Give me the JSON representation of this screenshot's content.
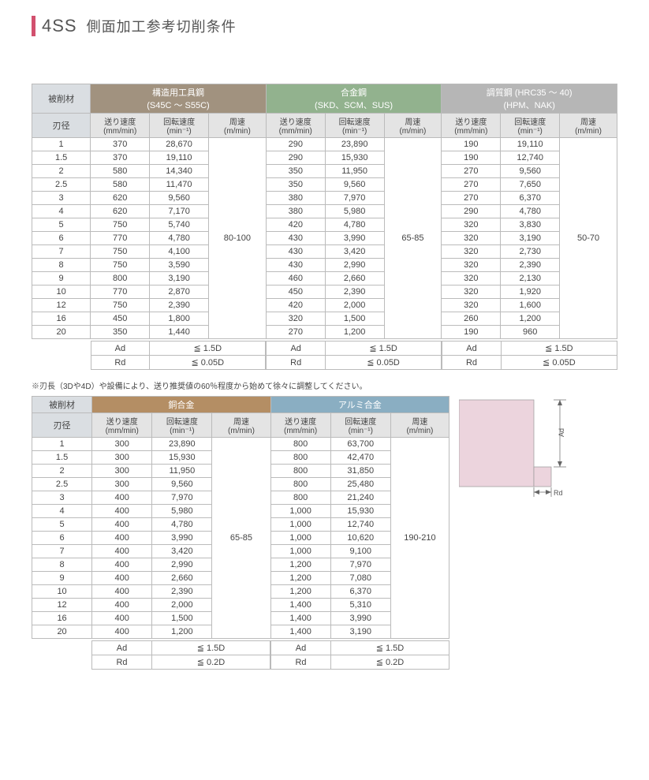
{
  "title": {
    "code": "4SS",
    "text": "側面加工参考切削条件"
  },
  "labels": {
    "material": "被削材",
    "diameter": "刃径",
    "feed": "送り速度",
    "feed_unit": "(mm/min)",
    "rotation": "回転速度",
    "rotation_unit": "(min⁻¹)",
    "surface": "周速",
    "surface_unit": "(m/min)",
    "ad": "Ad",
    "rd": "Rd",
    "le15d": "≦ 1.5D",
    "le005d": "≦ 0.05D",
    "le02d": "≦ 0.2D"
  },
  "note": "※刃長（3Dや4D）や設備により、送り推奨値の60％程度から始めて徐々に調整してください。",
  "diameters": [
    "1",
    "1.5",
    "2",
    "2.5",
    "3",
    "4",
    "5",
    "6",
    "7",
    "8",
    "9",
    "10",
    "12",
    "16",
    "20"
  ],
  "block1_groups": [
    {
      "title": "構造用工具鋼",
      "sub": "(S45C ～ S55C)",
      "cls": "g1",
      "surf": "80-100",
      "rows": [
        [
          "370",
          "28,670"
        ],
        [
          "370",
          "19,110"
        ],
        [
          "580",
          "14,340"
        ],
        [
          "580",
          "11,470"
        ],
        [
          "620",
          "9,560"
        ],
        [
          "620",
          "7,170"
        ],
        [
          "750",
          "5,740"
        ],
        [
          "770",
          "4,780"
        ],
        [
          "750",
          "4,100"
        ],
        [
          "750",
          "3,590"
        ],
        [
          "800",
          "3,190"
        ],
        [
          "770",
          "2,870"
        ],
        [
          "750",
          "2,390"
        ],
        [
          "450",
          "1,800"
        ],
        [
          "350",
          "1,440"
        ]
      ]
    },
    {
      "title": "合金鋼",
      "sub": "(SKD、SCM、SUS)",
      "cls": "g2",
      "surf": "65-85",
      "rows": [
        [
          "290",
          "23,890"
        ],
        [
          "290",
          "15,930"
        ],
        [
          "350",
          "11,950"
        ],
        [
          "350",
          "9,560"
        ],
        [
          "380",
          "7,970"
        ],
        [
          "380",
          "5,980"
        ],
        [
          "420",
          "4,780"
        ],
        [
          "430",
          "3,990"
        ],
        [
          "430",
          "3,420"
        ],
        [
          "430",
          "2,990"
        ],
        [
          "460",
          "2,660"
        ],
        [
          "450",
          "2,390"
        ],
        [
          "420",
          "2,000"
        ],
        [
          "320",
          "1,500"
        ],
        [
          "270",
          "1,200"
        ]
      ]
    },
    {
      "title": "調質鋼 (HRC35 ～ 40)",
      "sub": "(HPM、NAK)",
      "cls": "g3",
      "surf": "50-70",
      "rows": [
        [
          "190",
          "19,110"
        ],
        [
          "190",
          "12,740"
        ],
        [
          "270",
          "9,560"
        ],
        [
          "270",
          "7,650"
        ],
        [
          "270",
          "6,370"
        ],
        [
          "290",
          "4,780"
        ],
        [
          "320",
          "3,830"
        ],
        [
          "320",
          "3,190"
        ],
        [
          "320",
          "2,730"
        ],
        [
          "320",
          "2,390"
        ],
        [
          "320",
          "2,130"
        ],
        [
          "320",
          "1,920"
        ],
        [
          "320",
          "1,600"
        ],
        [
          "260",
          "1,200"
        ],
        [
          "190",
          "960"
        ]
      ]
    }
  ],
  "block2_groups": [
    {
      "title": "銅合金",
      "sub": "",
      "cls": "g4",
      "surf": "65-85",
      "rows": [
        [
          "300",
          "23,890"
        ],
        [
          "300",
          "15,930"
        ],
        [
          "300",
          "11,950"
        ],
        [
          "300",
          "9,560"
        ],
        [
          "400",
          "7,970"
        ],
        [
          "400",
          "5,980"
        ],
        [
          "400",
          "4,780"
        ],
        [
          "400",
          "3,990"
        ],
        [
          "400",
          "3,420"
        ],
        [
          "400",
          "2,990"
        ],
        [
          "400",
          "2,660"
        ],
        [
          "400",
          "2,390"
        ],
        [
          "400",
          "2,000"
        ],
        [
          "400",
          "1,500"
        ],
        [
          "400",
          "1,200"
        ]
      ]
    },
    {
      "title": "アルミ合金",
      "sub": "",
      "cls": "g5",
      "surf": "190-210",
      "rows": [
        [
          "800",
          "63,700"
        ],
        [
          "800",
          "42,470"
        ],
        [
          "800",
          "31,850"
        ],
        [
          "800",
          "25,480"
        ],
        [
          "800",
          "21,240"
        ],
        [
          "1,000",
          "15,930"
        ],
        [
          "1,000",
          "12,740"
        ],
        [
          "1,000",
          "10,620"
        ],
        [
          "1,000",
          "9,100"
        ],
        [
          "1,200",
          "7,970"
        ],
        [
          "1,200",
          "7,080"
        ],
        [
          "1,200",
          "6,370"
        ],
        [
          "1,400",
          "5,310"
        ],
        [
          "1,400",
          "3,990"
        ],
        [
          "1,400",
          "3,190"
        ]
      ]
    }
  ],
  "block1_rd": "le005d",
  "block2_rd": "le02d",
  "diagram": {
    "ad": "Ad",
    "rd": "Rd"
  }
}
